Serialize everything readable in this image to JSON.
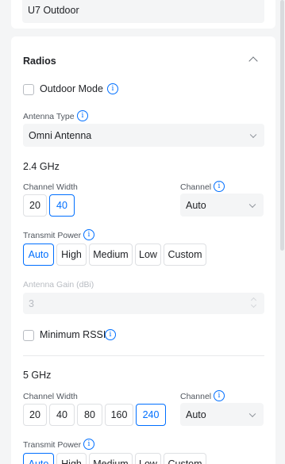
{
  "device_name": {
    "value": "U7 Outdoor"
  },
  "radios": {
    "title": "Radios",
    "outdoor_mode_label": "Outdoor Mode",
    "antenna_type_label": "Antenna Type",
    "antenna_type_value": "Omni Antenna",
    "band_24": {
      "title": "2.4 GHz",
      "channel_width_label": "Channel Width",
      "channel_widths": [
        "20",
        "40"
      ],
      "channel_width_selected": "40",
      "channel_label": "Channel",
      "channel_value": "Auto",
      "transmit_power_label": "Transmit Power",
      "transmit_powers": [
        "Auto",
        "High",
        "Medium",
        "Low",
        "Custom"
      ],
      "transmit_power_selected": "Auto",
      "antenna_gain_label": "Antenna Gain (dBi)",
      "antenna_gain_value": "3",
      "minimum_rssi_label": "Minimum RSSI"
    },
    "band_5": {
      "title": "5 GHz",
      "channel_width_label": "Channel Width",
      "channel_widths": [
        "20",
        "40",
        "80",
        "160",
        "240"
      ],
      "channel_width_selected": "240",
      "channel_label": "Channel",
      "channel_value": "Auto",
      "transmit_power_label": "Transmit Power",
      "transmit_powers": [
        "Auto",
        "High",
        "Medium",
        "Low",
        "Custom"
      ],
      "transmit_power_selected": "Auto"
    }
  },
  "icons": {
    "info": "info-icon",
    "collapse": "chevron-up-icon",
    "dropdown": "chevron-down-icon"
  },
  "colors": {
    "accent": "#006fff",
    "background": "#f4f5f6",
    "card": "#ffffff"
  }
}
